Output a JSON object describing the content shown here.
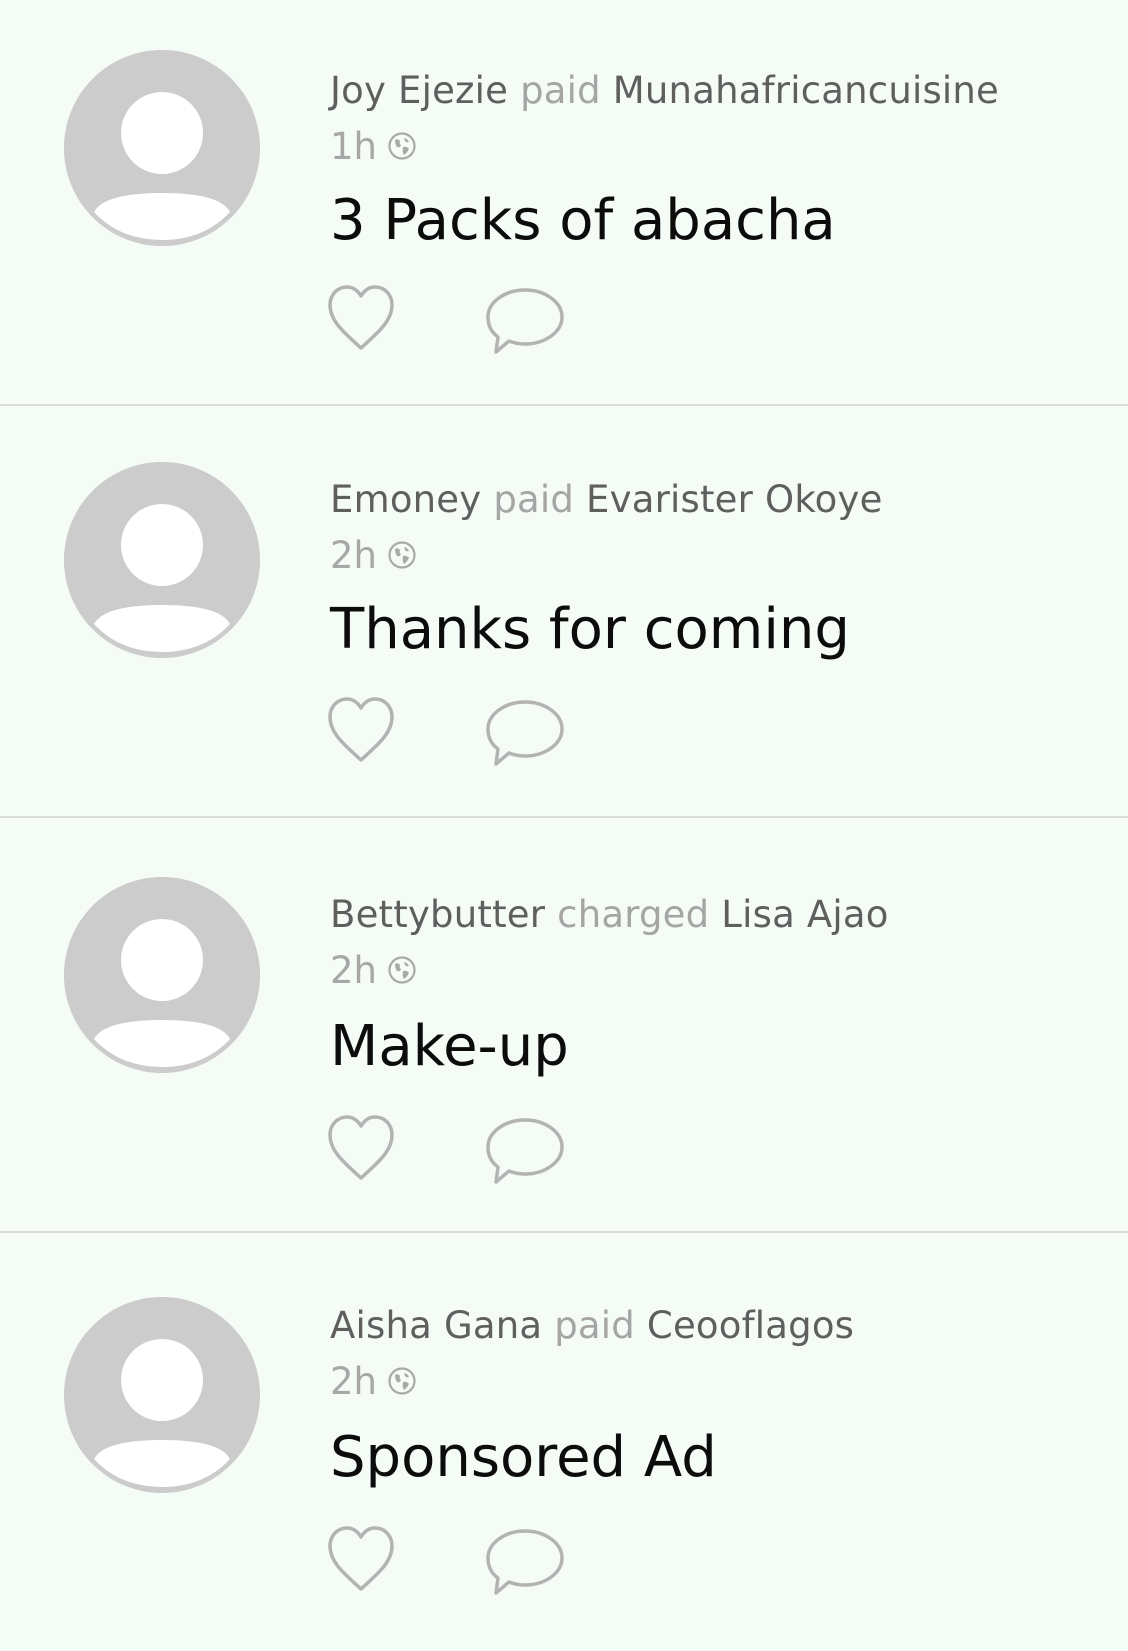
{
  "feed": {
    "items": [
      {
        "actor": "Joy Ejezie",
        "verb": "paid",
        "target": "Munahafricancuisine",
        "time": "1h",
        "note": "3 Packs of abacha"
      },
      {
        "actor": "Emoney",
        "verb": "paid",
        "target": "Evarister Okoye",
        "time": "2h",
        "note": "Thanks for coming"
      },
      {
        "actor": "Bettybutter",
        "verb": "charged",
        "target": "Lisa Ajao",
        "time": "2h",
        "note": "Make-up"
      },
      {
        "actor": "Aisha Gana",
        "verb": "paid",
        "target": "Ceooflagos",
        "time": "2h",
        "note": "Sponsored Ad"
      }
    ],
    "icons": {
      "avatar": "user-avatar-placeholder",
      "visibility": "globe-icon",
      "like": "heart-icon",
      "comment": "comment-bubble-icon"
    },
    "colors": {
      "background": "#f5fcf6",
      "avatar": "#cccccc",
      "name": "#5f5f5f",
      "verb": "#a5a5a5",
      "note": "#0c0c0c",
      "icon": "#b3b3b3",
      "divider": "#d9dcda"
    }
  }
}
